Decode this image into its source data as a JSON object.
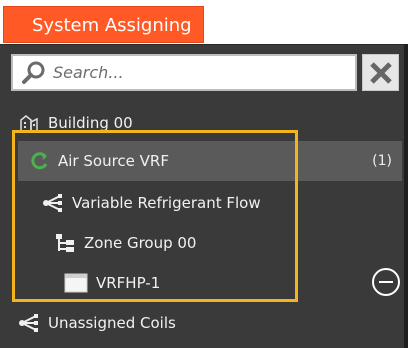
{
  "window": {
    "title": "System Assigning"
  },
  "search": {
    "placeholder": "Search...",
    "value": ""
  },
  "tree": {
    "items": [
      {
        "label": "Building 00",
        "icon": "building-icon",
        "level": 0
      },
      {
        "label": "Air Source VRF",
        "icon": "refresh-cycle-icon",
        "level": 1,
        "count": "(1)",
        "selected": true
      },
      {
        "label": "Variable Refrigerant Flow",
        "icon": "branch-network-icon",
        "level": 2
      },
      {
        "label": "Zone Group 00",
        "icon": "hierarchy-tree-icon",
        "level": 3
      },
      {
        "label": "VRFHP-1",
        "icon": "unit-box-icon",
        "level": 4
      },
      {
        "label": "Unassigned Coils",
        "icon": "branch-network-icon",
        "level": 0
      }
    ]
  },
  "colors": {
    "title_tab": "#ff5a26",
    "panel_bg": "#3a3a3a",
    "selected_row": "#5a5a5a",
    "highlight": "#f2b61c",
    "cycle_icon": "#4caf50"
  }
}
